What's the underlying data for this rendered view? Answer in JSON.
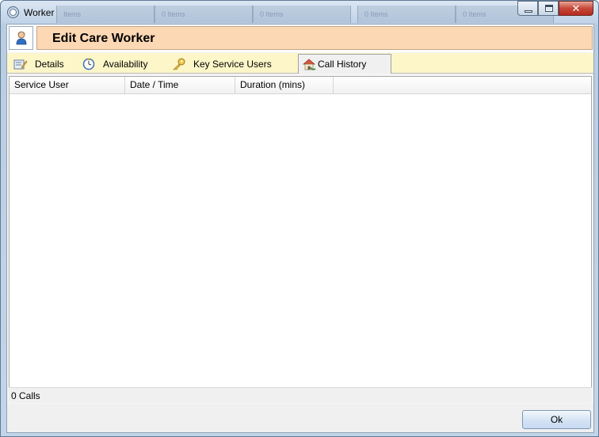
{
  "window": {
    "title": "Worker",
    "background_tabs": [
      "Items",
      "0 Items",
      "0 Items",
      "0 Items",
      "0 Items"
    ]
  },
  "header": {
    "title": "Edit Care Worker",
    "accent_color": "#fdd8b4"
  },
  "tabs": [
    {
      "label": "Details",
      "icon": "details-icon",
      "active": false
    },
    {
      "label": "Availability",
      "icon": "clock-icon",
      "active": false
    },
    {
      "label": "Key Service Users",
      "icon": "key-icon",
      "active": false
    },
    {
      "label": "Call History",
      "icon": "house-phone-icon",
      "active": true
    }
  ],
  "grid": {
    "columns": [
      "Service User",
      "Date / Time",
      "Duration (mins)"
    ],
    "rows": []
  },
  "status": {
    "count_text": "0 Calls"
  },
  "buttons": {
    "ok_label": "Ok"
  }
}
